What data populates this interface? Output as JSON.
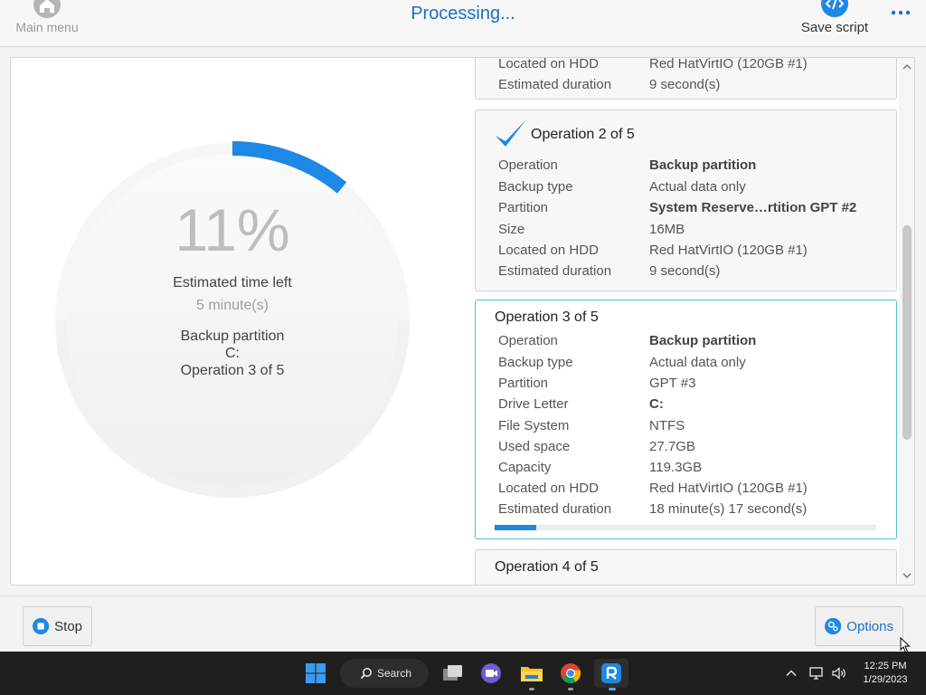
{
  "header": {
    "main_menu_label": "Main menu",
    "title": "Processing...",
    "save_script_label": "Save script"
  },
  "progress": {
    "percent_text": "11%",
    "percent_value": 11,
    "estimated_label": "Estimated time left",
    "estimated_value": "5 minute(s)",
    "current_action": "Backup partition",
    "current_target": "C:",
    "current_op": "Operation 3 of 5"
  },
  "op1": {
    "rows": [
      {
        "key": "Located on HDD",
        "value": "Red HatVirtIO (120GB #1)"
      },
      {
        "key": "Estimated duration",
        "value": "9 second(s)"
      }
    ]
  },
  "op2": {
    "title": "Operation 2 of 5",
    "rows": [
      {
        "key": "Operation",
        "value": "Backup partition"
      },
      {
        "key": "Backup type",
        "value": "Actual data only"
      },
      {
        "key": "Partition",
        "value": "System Reserve…rtition GPT #2"
      },
      {
        "key": "Size",
        "value": "16MB"
      },
      {
        "key": "Located on HDD",
        "value": "Red HatVirtIO (120GB #1)"
      },
      {
        "key": "Estimated duration",
        "value": "9 second(s)"
      }
    ]
  },
  "op3": {
    "title": "Operation 3 of 5",
    "progress_percent": 11,
    "rows": [
      {
        "key": "Operation",
        "value": "Backup partition"
      },
      {
        "key": "Backup type",
        "value": "Actual data only"
      },
      {
        "key": "Partition",
        "value": "GPT #3"
      },
      {
        "key": "Drive Letter",
        "value": "C:"
      },
      {
        "key": "File System",
        "value": "NTFS"
      },
      {
        "key": "Used space",
        "value": "27.7GB"
      },
      {
        "key": "Capacity",
        "value": "119.3GB"
      },
      {
        "key": "Located on HDD",
        "value": "Red HatVirtIO (120GB #1)"
      },
      {
        "key": "Estimated duration",
        "value": "18 minute(s) 17 second(s)"
      }
    ]
  },
  "op4": {
    "title": "Operation 4 of 5"
  },
  "footer": {
    "stop_label": "Stop",
    "options_label": "Options"
  },
  "taskbar": {
    "search_label": "Search",
    "time": "12:25 PM",
    "date": "1/29/2023"
  },
  "colors": {
    "accent": "#1e88e5",
    "title_blue": "#1e6fc2",
    "active_border": "#4fc3c8"
  }
}
